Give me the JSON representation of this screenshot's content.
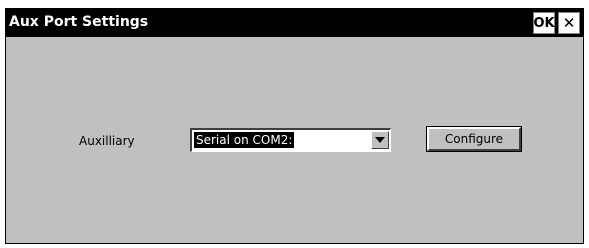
{
  "window": {
    "title": "Aux Port Settings",
    "ok_label": "OK",
    "close_glyph": "✕"
  },
  "form": {
    "auxiliary_label": "Auxilliary",
    "auxiliary_value": "Serial on COM2:",
    "configure_label": "Configure"
  },
  "icons": {
    "dropdown": "chevron-down-icon",
    "close": "close-icon"
  },
  "colors": {
    "titlebar": "#000000",
    "dialog_bg": "#c0c0c0",
    "selection_bg": "#000000",
    "selection_fg": "#ffffff"
  }
}
